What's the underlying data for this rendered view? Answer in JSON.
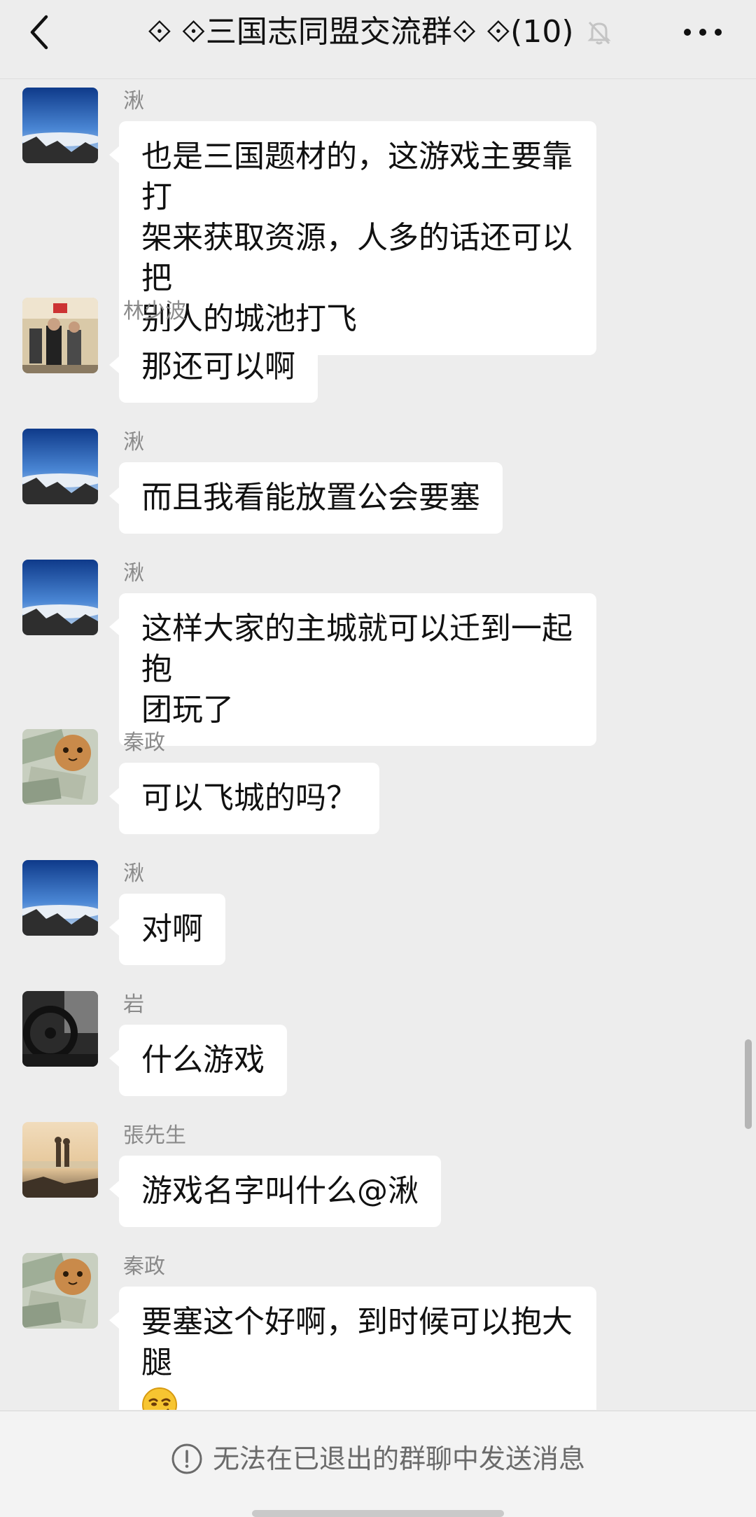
{
  "header": {
    "title": "⟐ ⟐三国志同盟交流群⟐ ⟐(10)",
    "back_icon": "chevron-left-icon",
    "mute_icon": "bell-off-icon",
    "more_icon": "more-dots-icon"
  },
  "messages": [
    {
      "sender": "湫",
      "lines": [
        "也是三国题材的，这游戏主要靠打",
        "架来获取资源，人多的话还可以把",
        "别人的城池打飞"
      ],
      "avatar": "mountain-sky"
    },
    {
      "sender": "林少波",
      "lines": [
        "那还可以啊"
      ],
      "avatar": "people-photo"
    },
    {
      "sender": "湫",
      "lines": [
        "而且我看能放置公会要塞"
      ],
      "avatar": "mountain-sky"
    },
    {
      "sender": "湫",
      "lines": [
        "这样大家的主城就可以迁到一起抱",
        "团玩了"
      ],
      "avatar": "mountain-sky"
    },
    {
      "sender": "秦政",
      "lines": [
        "可以飞城的吗？"
      ],
      "avatar": "money-cat"
    },
    {
      "sender": "湫",
      "lines": [
        "对啊"
      ],
      "avatar": "mountain-sky"
    },
    {
      "sender": "岩",
      "lines": [
        "什么游戏"
      ],
      "avatar": "car-interior"
    },
    {
      "sender": "張先生",
      "lines": [
        "游戏名字叫什么@湫"
      ],
      "avatar": "beach-couple"
    },
    {
      "sender": "秦政",
      "lines": [
        "要塞这个好啊，到时候可以抱大腿"
      ],
      "avatar": "money-cat",
      "emoji": "smirk-emoji"
    }
  ],
  "footer": {
    "notice": "无法在已退出的群聊中发送消息",
    "notice_icon": "exclamation-circle-icon"
  }
}
